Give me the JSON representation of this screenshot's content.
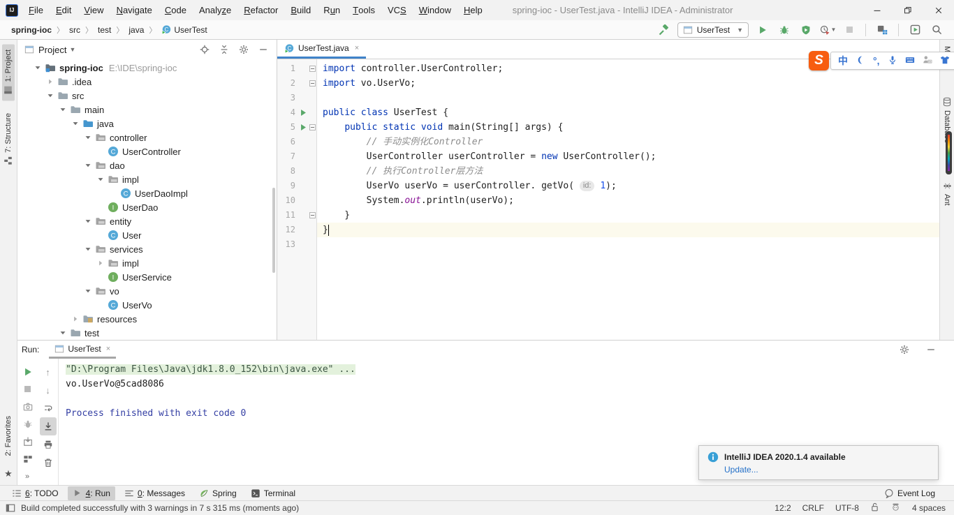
{
  "window": {
    "title": "spring-ioc - UserTest.java - IntelliJ IDEA - Administrator",
    "controls": [
      {
        "name": "minimize",
        "icon": "win-min"
      },
      {
        "name": "restore",
        "icon": "win-restore"
      },
      {
        "name": "close",
        "icon": "win-close"
      }
    ]
  },
  "menubar": [
    {
      "t": "File",
      "m": 0
    },
    {
      "t": "Edit",
      "m": 0
    },
    {
      "t": "View",
      "m": 0
    },
    {
      "t": "Navigate",
      "m": 0
    },
    {
      "t": "Code",
      "m": 0
    },
    {
      "t": "Analyze",
      "m": 5
    },
    {
      "t": "Refactor",
      "m": 0
    },
    {
      "t": "Build",
      "m": 0
    },
    {
      "t": "Run",
      "m": 1
    },
    {
      "t": "Tools",
      "m": 0
    },
    {
      "t": "VCS",
      "m": 2
    },
    {
      "t": "Window",
      "m": 0
    },
    {
      "t": "Help",
      "m": 0
    }
  ],
  "breadcrumbs": [
    {
      "label": "spring-ioc",
      "bold": true
    },
    {
      "label": "src"
    },
    {
      "label": "test"
    },
    {
      "label": "java"
    },
    {
      "label": "UserTest",
      "icon": "class-run"
    }
  ],
  "toolbar": {
    "run_config": "UserTest",
    "buttons": [
      {
        "icon": "play",
        "name": "run-button"
      },
      {
        "icon": "bug",
        "name": "debug-button"
      },
      {
        "icon": "coverage",
        "name": "run-with-coverage-button"
      },
      {
        "icon": "profiler",
        "name": "profiler-button",
        "caret": true
      },
      {
        "icon": "stop-disabled",
        "name": "stop-button"
      },
      {
        "sep": true
      },
      {
        "icon": "structure",
        "name": "project-structure-button"
      },
      {
        "sep": true
      },
      {
        "icon": "window-play",
        "name": "run-anything-button"
      },
      {
        "icon": "search",
        "name": "search-everywhere-button"
      }
    ]
  },
  "left_stripe": {
    "top": [
      {
        "label": "1: Project",
        "icon": "stripe-project",
        "active": true
      },
      {
        "label": "7: Structure",
        "icon": "stripe-structure",
        "active": false
      }
    ],
    "bottom": [
      {
        "label": "2: Favorites",
        "icon": null,
        "active": false
      }
    ],
    "star": "★"
  },
  "right_stripe": [
    {
      "label": "Maven",
      "icon": null
    },
    {
      "label": "Database",
      "icon": "database"
    },
    {
      "label": "Ant",
      "icon": "ant"
    }
  ],
  "project_panel": {
    "title": "Project",
    "header_icons": [
      {
        "icon": "locate",
        "name": "locate-button"
      },
      {
        "icon": "collapse-all",
        "name": "collapse-all-button"
      },
      {
        "icon": "gear",
        "name": "settings-button"
      },
      {
        "icon": "minus",
        "name": "hide-panel-button"
      }
    ],
    "tree": [
      {
        "label": "spring-ioc",
        "path": "E:\\IDE\\spring-ioc",
        "icon": "folder-root",
        "level": 0,
        "chevron": "expanded",
        "bold": true
      },
      {
        "label": ".idea",
        "icon": "folder",
        "level": 1,
        "chevron": "collapsed"
      },
      {
        "label": "src",
        "icon": "folder",
        "level": 1,
        "chevron": "expanded"
      },
      {
        "label": "main",
        "icon": "folder",
        "level": 2,
        "chevron": "expanded"
      },
      {
        "label": "java",
        "icon": "folder-src",
        "level": 3,
        "chevron": "expanded"
      },
      {
        "label": "controller",
        "icon": "package",
        "level": 4,
        "chevron": "expanded"
      },
      {
        "label": "UserController",
        "icon": "class",
        "level": 5
      },
      {
        "label": "dao",
        "icon": "package",
        "level": 4,
        "chevron": "expanded"
      },
      {
        "label": "impl",
        "icon": "package",
        "level": 5,
        "chevron": "expanded"
      },
      {
        "label": "UserDaoImpl",
        "icon": "class",
        "level": 6
      },
      {
        "label": "UserDao",
        "icon": "interface",
        "level": 5
      },
      {
        "label": "entity",
        "icon": "package",
        "level": 4,
        "chevron": "expanded"
      },
      {
        "label": "User",
        "icon": "class",
        "level": 5
      },
      {
        "label": "services",
        "icon": "package",
        "level": 4,
        "chevron": "expanded"
      },
      {
        "label": "impl",
        "icon": "package",
        "level": 5,
        "chevron": "collapsed"
      },
      {
        "label": "UserService",
        "icon": "interface",
        "level": 5
      },
      {
        "label": "vo",
        "icon": "package",
        "level": 4,
        "chevron": "expanded"
      },
      {
        "label": "UserVo",
        "icon": "class",
        "level": 5
      },
      {
        "label": "resources",
        "icon": "folder-resources",
        "level": 3,
        "chevron": "collapsed"
      },
      {
        "label": "test",
        "icon": "folder",
        "level": 2,
        "chevron": "expanded"
      }
    ]
  },
  "editor": {
    "tab": {
      "label": "UserTest.java",
      "icon": "class-run",
      "close": "×"
    },
    "lines": [
      {
        "n": 1,
        "fold": true,
        "seg": [
          [
            "k",
            "import"
          ],
          [
            "p",
            " controller.UserController;"
          ]
        ]
      },
      {
        "n": 2,
        "fold": true,
        "seg": [
          [
            "k",
            "import"
          ],
          [
            "p",
            " vo.UserVo;"
          ]
        ]
      },
      {
        "n": 3,
        "seg": []
      },
      {
        "n": 4,
        "run": true,
        "seg": [
          [
            "k",
            "public"
          ],
          [
            "p",
            " "
          ],
          [
            "k",
            "class"
          ],
          [
            "p",
            " UserTest {"
          ]
        ]
      },
      {
        "n": 5,
        "run": true,
        "fold": true,
        "seg": [
          [
            "p",
            "    "
          ],
          [
            "k",
            "public"
          ],
          [
            "p",
            " "
          ],
          [
            "k",
            "static"
          ],
          [
            "p",
            " "
          ],
          [
            "k",
            "void"
          ],
          [
            "p",
            " main(String[] args) {"
          ]
        ]
      },
      {
        "n": 6,
        "seg": [
          [
            "p",
            "        "
          ],
          [
            "c",
            "// 手动实例化Controller"
          ]
        ]
      },
      {
        "n": 7,
        "seg": [
          [
            "p",
            "        UserController userController = "
          ],
          [
            "k",
            "new"
          ],
          [
            "p",
            " UserController();"
          ]
        ]
      },
      {
        "n": 8,
        "seg": [
          [
            "p",
            "        "
          ],
          [
            "c",
            "// 执行Controller层方法"
          ]
        ]
      },
      {
        "n": 9,
        "seg": [
          [
            "p",
            "        UserVo userVo = userController. getVo( "
          ],
          [
            "h",
            "id:"
          ],
          [
            "p",
            " "
          ],
          [
            "n",
            "1"
          ],
          [
            "p",
            ");"
          ]
        ]
      },
      {
        "n": 10,
        "seg": [
          [
            "p",
            "        System."
          ],
          [
            "f",
            "out"
          ],
          [
            "p",
            ".println(userVo);"
          ]
        ]
      },
      {
        "n": 11,
        "fold": true,
        "seg": [
          [
            "p",
            "    }"
          ]
        ]
      },
      {
        "n": 12,
        "current": true,
        "caret": true,
        "seg": [
          [
            "p",
            "}"
          ]
        ]
      },
      {
        "n": 13,
        "seg": []
      }
    ]
  },
  "run_panel": {
    "label": "Run:",
    "tab": {
      "label": "UserTest",
      "icon": "appwin",
      "close": "×"
    },
    "header_icons": [
      {
        "icon": "gear",
        "name": "run-settings-button"
      },
      {
        "icon": "minus",
        "name": "hide-run-panel-button"
      }
    ],
    "toolbar_col1": [
      {
        "icon": "rerun",
        "name": "rerun-button"
      },
      {
        "icon": "stop-gray",
        "name": "stop-process-button"
      },
      {
        "icon": "camera",
        "name": "dump-threads-button"
      },
      {
        "icon": "restart-debug",
        "name": "restart-debug-button"
      },
      {
        "icon": "into-box",
        "name": "show-running-list-button"
      },
      {
        "icon": "layout",
        "name": "restore-layout-button"
      },
      {
        "icon": "more",
        "name": "more-actions-button"
      }
    ],
    "toolbar_col2": [
      {
        "icon": "up",
        "name": "up-stack-trace-button"
      },
      {
        "icon": "down",
        "name": "down-stack-trace-button"
      },
      {
        "icon": "softwrap",
        "name": "soft-wrap-button"
      },
      {
        "icon": "scrollend",
        "name": "scroll-to-end-button",
        "active": true
      },
      {
        "icon": "printer",
        "name": "print-button"
      },
      {
        "icon": "trash",
        "name": "clear-all-button"
      }
    ],
    "console": [
      {
        "s": "cmd",
        "t": "\"D:\\Program Files\\Java\\jdk1.8.0_152\\bin\\java.exe\" ..."
      },
      {
        "s": "out",
        "t": "vo.UserVo@5cad8086"
      },
      {
        "s": "out",
        "t": ""
      },
      {
        "s": "sys",
        "t": "Process finished with exit code 0"
      }
    ]
  },
  "bottom_bar": {
    "items": [
      {
        "num": "6",
        "label": "TODO",
        "icon": "todo",
        "active": false
      },
      {
        "num": "4",
        "label": "Run",
        "icon": "run-small",
        "active": true
      },
      {
        "num": "0",
        "label": "Messages",
        "icon": "messages",
        "active": false
      },
      {
        "num": null,
        "label": "Spring",
        "icon": "leaf",
        "active": false
      },
      {
        "num": null,
        "label": "Terminal",
        "icon": "terminal",
        "active": false
      }
    ],
    "event_log": "Event Log"
  },
  "status_bar": {
    "message": "Build completed successfully with 3 warnings in 7 s 315 ms (moments ago)",
    "right": [
      {
        "type": "text",
        "v": "12:2",
        "name": "cursor-position"
      },
      {
        "type": "text",
        "v": "CRLF",
        "name": "line-separator"
      },
      {
        "type": "text",
        "v": "UTF-8",
        "name": "file-encoding"
      },
      {
        "type": "icon",
        "v": "lock-open",
        "name": "readonly-toggle"
      },
      {
        "type": "icon",
        "v": "face",
        "name": "ide-face"
      },
      {
        "type": "text",
        "v": "4 spaces",
        "name": "indent-info"
      }
    ]
  },
  "notification": {
    "title": "IntelliJ IDEA 2020.1.4 available",
    "link": "Update..."
  },
  "ime_bar": {
    "logo": "S",
    "items": [
      {
        "type": "text",
        "v": "中",
        "name": "ime-chinese-mode"
      },
      {
        "type": "icon",
        "v": "moon",
        "name": "ime-fullhalf-mode"
      },
      {
        "type": "text",
        "v": "°,",
        "name": "ime-punctuation-mode"
      },
      {
        "type": "icon",
        "v": "mic",
        "name": "ime-voice-input"
      },
      {
        "type": "icon",
        "v": "keyboard",
        "name": "ime-soft-keyboard"
      },
      {
        "type": "icon",
        "v": "person13",
        "name": "ime-login"
      },
      {
        "type": "icon",
        "v": "tshirt",
        "name": "ime-skin"
      },
      {
        "type": "icon",
        "v": "wrench",
        "name": "ime-settings"
      }
    ]
  },
  "colors": {
    "accent_tab_underline": "#4083c9",
    "keyword": "#0033b3",
    "comment": "#8c8c8c",
    "field": "#871094",
    "number": "#1750eb",
    "console_system": "#333ea3",
    "run_green": "#59a869",
    "caret_row": "#fcfaed"
  }
}
